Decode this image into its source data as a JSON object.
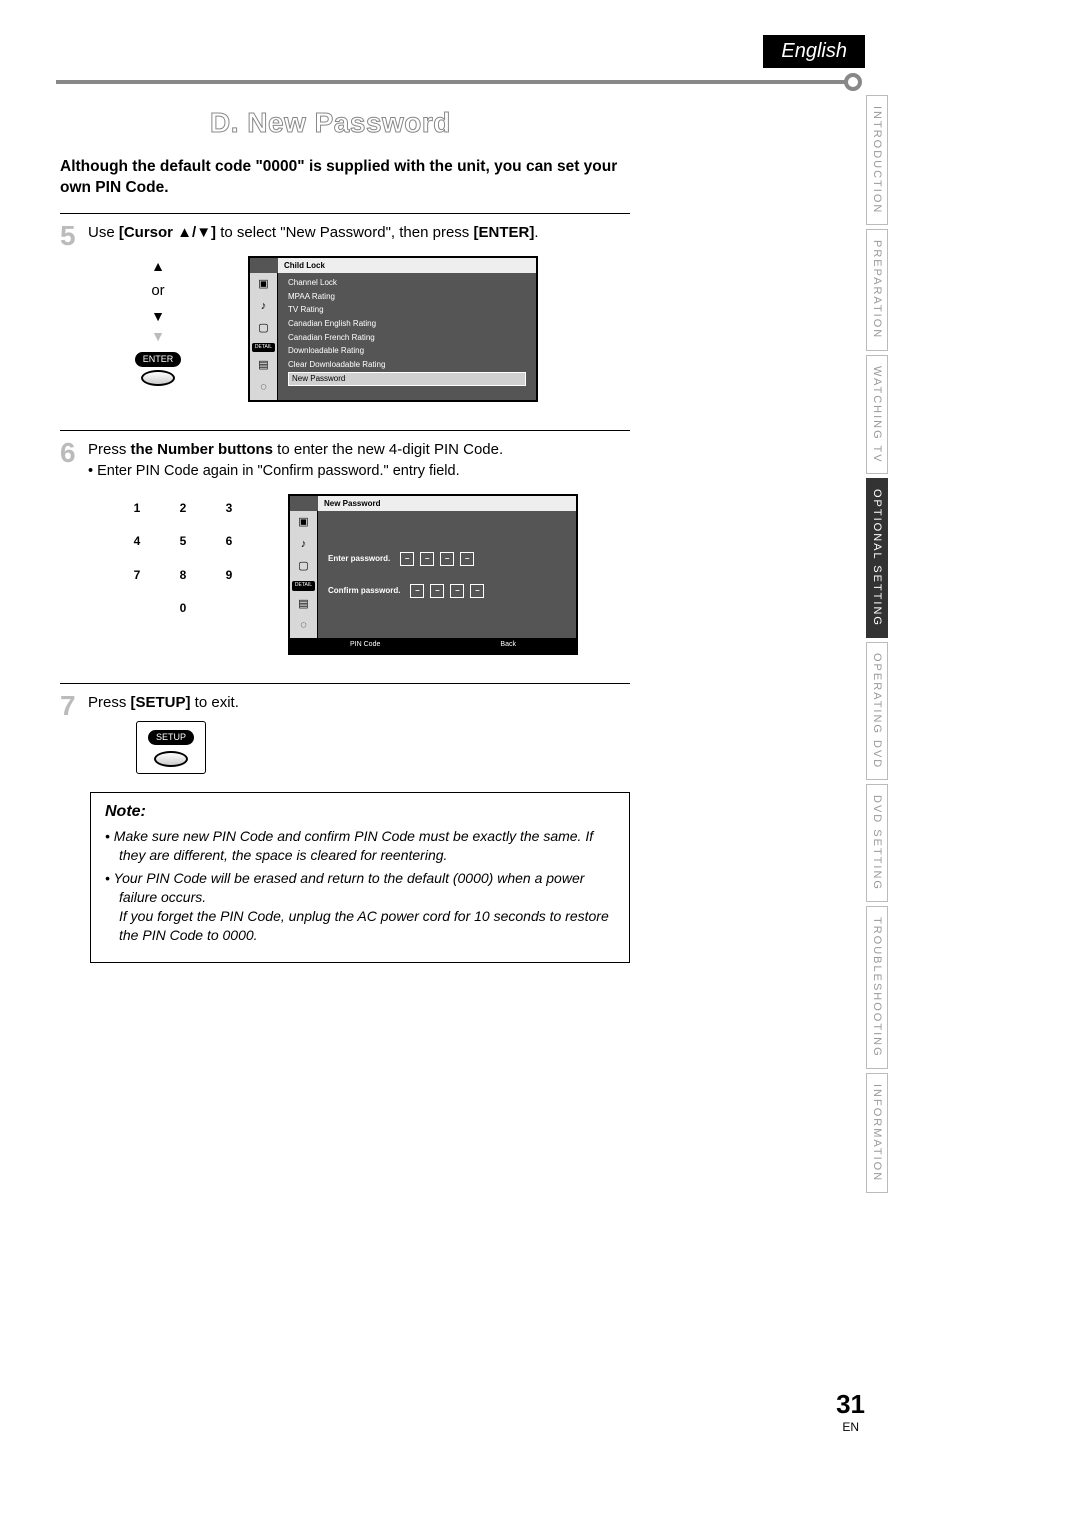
{
  "header": {
    "language": "English"
  },
  "side_tabs": [
    {
      "label": "INTRODUCTION",
      "active": false
    },
    {
      "label": "PREPARATION",
      "active": false
    },
    {
      "label": "WATCHING TV",
      "active": false
    },
    {
      "label": "OPTIONAL SETTING",
      "active": true
    },
    {
      "label": "OPERATING DVD",
      "active": false
    },
    {
      "label": "DVD SETTING",
      "active": false
    },
    {
      "label": "TROUBLESHOOTING",
      "active": false
    },
    {
      "label": "INFORMATION",
      "active": false
    }
  ],
  "section_title": "D. New Password",
  "intro": "Although the default code \"0000\" is supplied with the unit, you can set your own PIN Code.",
  "step5": {
    "num": "5",
    "text_pre": "Use ",
    "cursor_label": "[Cursor ▲/▼]",
    "text_mid1": " to select \"New Password\", then press ",
    "enter_label": "[ENTER]",
    "text_end": ".",
    "remote": {
      "up": "▲",
      "or": "or",
      "down": "▼",
      "dim_down": "▼",
      "enter": "ENTER"
    },
    "screen_title": "Child Lock",
    "screen_detail": "DETAIL",
    "menu": [
      "Channel Lock",
      "MPAA Rating",
      "TV Rating",
      "Canadian English Rating",
      "Canadian French Rating",
      "Downloadable Rating",
      "Clear Downloadable Rating"
    ],
    "menu_selected": "New Password"
  },
  "step6": {
    "num": "6",
    "text_pre": "Press ",
    "bold": "the Number buttons",
    "text_mid": " to enter the new 4-digit PIN Code.",
    "bullet": "Enter PIN Code again in \"Confirm password.\" entry field.",
    "keypad": [
      "1",
      "2",
      "3",
      "4",
      "5",
      "6",
      "7",
      "8",
      "9",
      "0"
    ],
    "screen_title": "New Password",
    "screen_detail": "DETAIL",
    "enter_pw": "Enter password.",
    "confirm_pw": "Confirm password.",
    "dash": "–",
    "footer_pin": "PIN Code",
    "footer_back": "Back"
  },
  "step7": {
    "num": "7",
    "text_pre": "Press ",
    "bold": "[SETUP]",
    "text_end": " to exit.",
    "setup_label": "SETUP"
  },
  "note": {
    "title": "Note:",
    "n1": "Make sure new PIN Code and confirm PIN Code must be exactly the same. If they are different, the space is cleared for reentering.",
    "n2a": "Your PIN Code will be erased and return to the default (0000) when a power failure occurs.",
    "n2b": "If you forget the PIN Code, unplug the AC power cord for 10 seconds to restore the PIN Code to 0000."
  },
  "footer": {
    "page": "31",
    "lang": "EN"
  }
}
